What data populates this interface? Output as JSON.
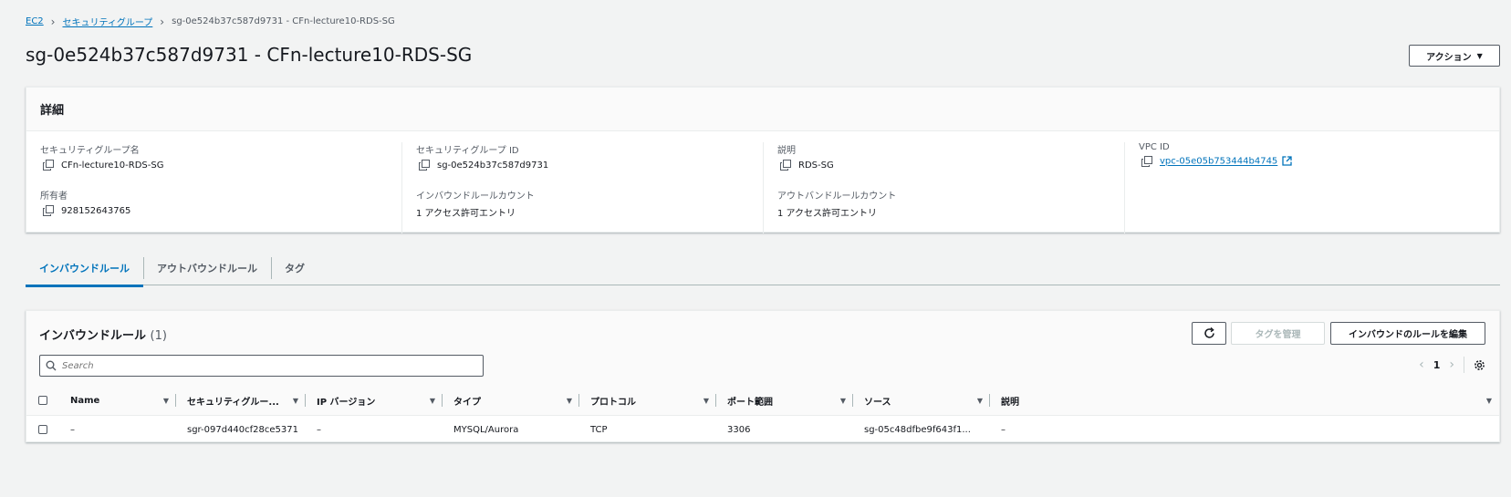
{
  "breadcrumb": {
    "root": "EC2",
    "section": "セキュリティグループ",
    "current": "sg-0e524b37c587d9731 - CFn-lecture10-RDS-SG"
  },
  "page": {
    "title": "sg-0e524b37c587d9731 - CFn-lecture10-RDS-SG",
    "action_label": "アクション"
  },
  "details": {
    "header": "詳細",
    "fields": {
      "sg_name": {
        "label": "セキュリティグループ名",
        "value": "CFn-lecture10-RDS-SG"
      },
      "sg_id": {
        "label": "セキュリティグループ ID",
        "value": "sg-0e524b37c587d9731"
      },
      "description": {
        "label": "説明",
        "value": "RDS-SG"
      },
      "vpc_id": {
        "label": "VPC ID",
        "value": "vpc-05e05b753444b4745"
      },
      "owner": {
        "label": "所有者",
        "value": "928152643765"
      },
      "inbound_count": {
        "label": "インバウンドルールカウント",
        "value": "1 アクセス許可エントリ"
      },
      "outbound_count": {
        "label": "アウトバンドルールカウント",
        "value": "1 アクセス許可エントリ"
      }
    }
  },
  "tabs": [
    {
      "label": "インバウンドルール",
      "active": true
    },
    {
      "label": "アウトバウンドルール",
      "active": false
    },
    {
      "label": "タグ",
      "active": false
    }
  ],
  "rules": {
    "title": "インバウンドルール",
    "count": "(1)",
    "manage_tags_label": "タグを管理",
    "edit_label": "インバウンドのルールを編集",
    "search_placeholder": "Search",
    "page": "1",
    "columns": [
      "Name",
      "セキュリティグルー...",
      "IP バージョン",
      "タイプ",
      "プロトコル",
      "ポート範囲",
      "ソース",
      "説明"
    ],
    "rows": [
      [
        "–",
        "sgr-097d440cf28ce5371",
        "–",
        "MYSQL/Aurora",
        "TCP",
        "3306",
        "sg-05c48dfbe9f643f1...",
        "–"
      ]
    ]
  },
  "colors": {
    "link": "#0073bb",
    "background": "#f2f3f3",
    "text": "#16191f"
  }
}
